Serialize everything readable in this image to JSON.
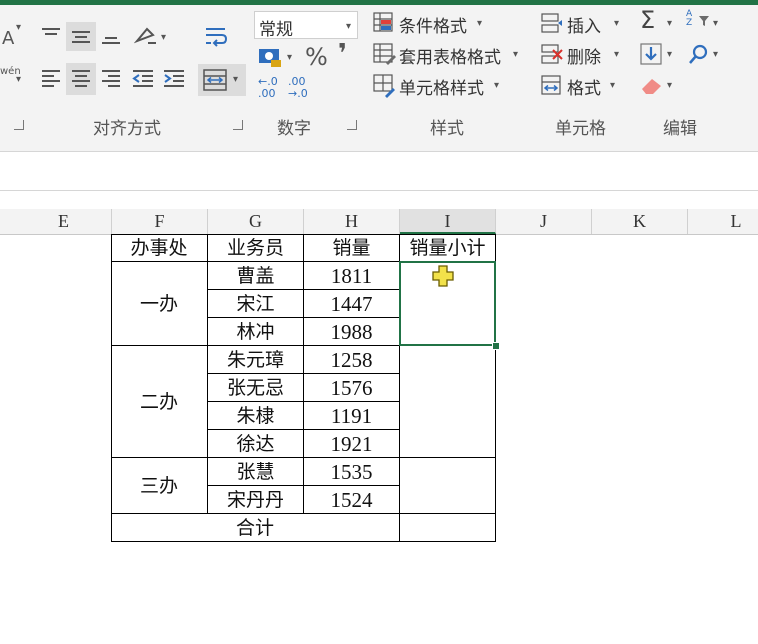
{
  "ribbon": {
    "number_format": "常规",
    "percent": "%",
    "comma": "❜",
    "decimals_increase": "←.0 .00",
    "decimals_decrease": ".00 →.0",
    "styles": {
      "conditional_format": "条件格式",
      "table_format": "套用表格格式",
      "cell_style": "单元格样式"
    },
    "cells": {
      "insert": "插入",
      "delete": "删除",
      "format": "格式"
    },
    "edit": {
      "sum": "Σ",
      "sort": "A Z"
    },
    "groups": {
      "alignment": "对齐方式",
      "number": "数字",
      "styles": "样式",
      "cells": "单元格",
      "editing": "编辑"
    },
    "left_partial": {
      "font_letter": "A",
      "wen": "wén"
    }
  },
  "columns": [
    "E",
    "F",
    "G",
    "H",
    "I",
    "J",
    "K",
    "L"
  ],
  "selected_column": "I",
  "table": {
    "headers": [
      "办事处",
      "业务员",
      "销量",
      "销量小计"
    ],
    "offices": [
      "一办",
      "二办",
      "三办"
    ],
    "rows": [
      {
        "name": "曹盖",
        "sales": "1811"
      },
      {
        "name": "宋江",
        "sales": "1447"
      },
      {
        "name": "林冲",
        "sales": "1988"
      },
      {
        "name": "朱元璋",
        "sales": "1258"
      },
      {
        "name": "张无忌",
        "sales": "1576"
      },
      {
        "name": "朱棣",
        "sales": "1191"
      },
      {
        "name": "徐达",
        "sales": "1921"
      },
      {
        "name": "张慧",
        "sales": "1535"
      },
      {
        "name": "宋丹丹",
        "sales": "1524"
      }
    ],
    "total_label": "合计"
  },
  "colors": {
    "accent": "#217346",
    "cursor": "#f2e24a"
  },
  "cursor_icon": "cell-select-cross-cursor"
}
